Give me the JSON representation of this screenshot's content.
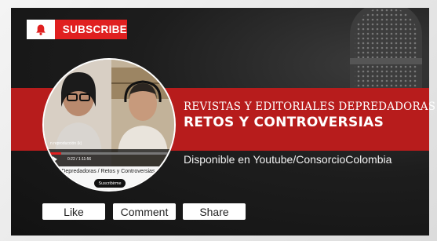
{
  "subscribe": {
    "label": "SUBSCRIBE",
    "icon": "bell-icon",
    "color": "#e02020"
  },
  "banner": {
    "line1": "REVISTAS Y EDITORIALES DEPREDADORAS",
    "line2": "RETOS Y CONTROVERSIAS",
    "color": "#b71c1c"
  },
  "availability": "Disponible en Youtube/ConsorcioColombia",
  "video_preview": {
    "overlay_label": "n reproducción (k)",
    "time": "0:22 / 1:11:56",
    "caption": "iales Depredadoras / Retos y Controversias",
    "caption_sub": "bia",
    "subscribe_button": "Suscribirme"
  },
  "actions": {
    "like": "Like",
    "comment": "Comment",
    "share": "Share"
  }
}
